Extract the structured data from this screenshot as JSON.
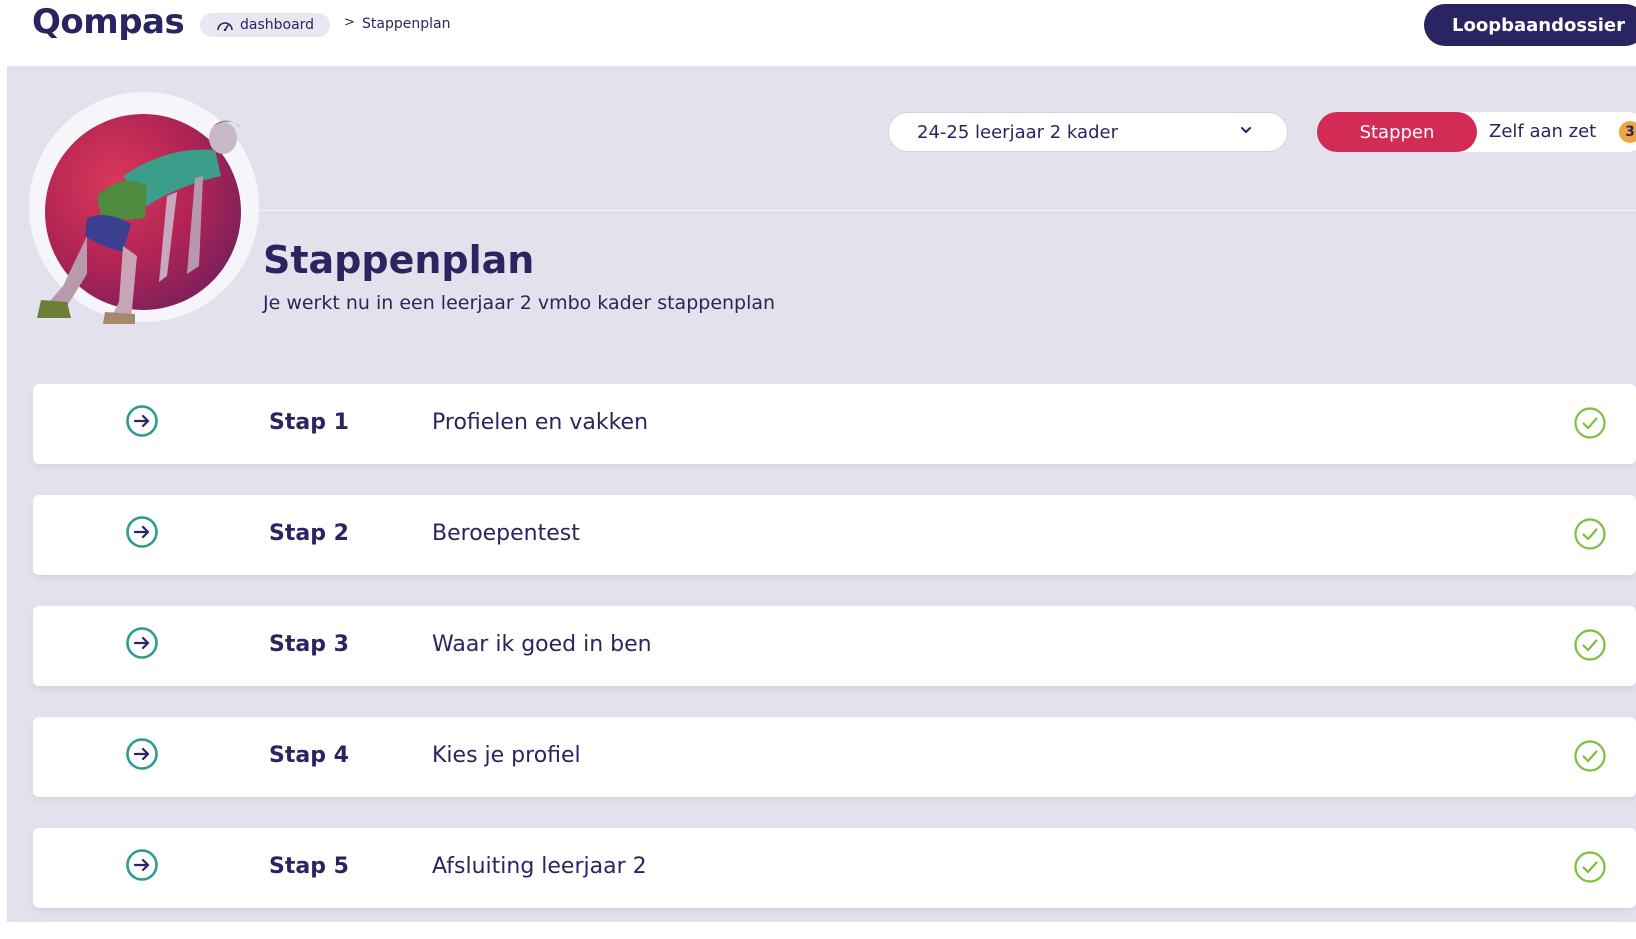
{
  "header": {
    "logo": "Qompas",
    "breadcrumb": {
      "home_icon": "dashboard-gauge-icon",
      "home_label": "dashboard",
      "separator": ">",
      "current": "Stappenplan"
    },
    "dossier_button": "Loopbaandossier"
  },
  "controls": {
    "year_select": {
      "value": "24-25 leerjaar 2 kader",
      "icon": "chevron-down-icon"
    },
    "toggle": {
      "active_label": "Stappen",
      "other_label": "Zelf aan zet",
      "badge_count": "3"
    }
  },
  "page": {
    "title": "Stappenplan",
    "subtitle": "Je werkt nu in een leerjaar 2 vmbo kader stappenplan"
  },
  "steps": [
    {
      "number": "Stap 1",
      "title": "Profielen en vakken",
      "completed": true
    },
    {
      "number": "Stap 2",
      "title": "Beroepentest",
      "completed": true
    },
    {
      "number": "Stap 3",
      "title": "Waar ik goed in ben",
      "completed": true
    },
    {
      "number": "Stap 4",
      "title": "Kies je profiel",
      "completed": true
    },
    {
      "number": "Stap 5",
      "title": "Afsluiting leerjaar 2",
      "completed": true
    }
  ],
  "colors": {
    "brand_navy": "#2b2463",
    "accent_red": "#d22c56",
    "arrow_teal": "#2f9b8f",
    "check_green": "#7cbf3a",
    "badge_orange": "#eea645",
    "background": "#e3e2ec"
  }
}
